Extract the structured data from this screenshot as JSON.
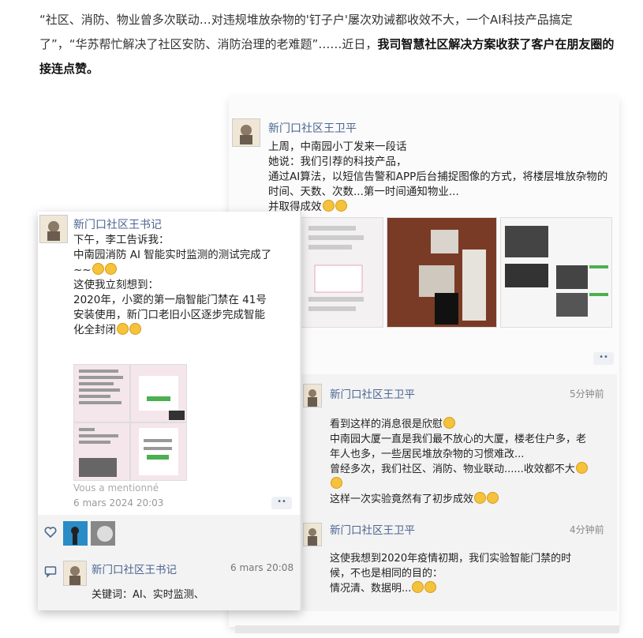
{
  "intro": {
    "part1": "“社区、消防、物业曾多次联动…对违规堆放杂物的'钉子户'屡次劝诫都收效不大，一个AI科技产品搞定了”，“华苏帮忙解决了社区安防、消防治理的老难题”……近日，",
    "bold": "我司智慧社区解决方案收获了客户在朋友圈的接连点赞。"
  },
  "back_post": {
    "author": "新门口社区王卫平",
    "lines": [
      "上周，中南园小丁发来一段话",
      "她说：我们引荐的科技产品，",
      "通过AI算法，以短信告警和APP后台捕捉图像的方式，将楼层堆放杂物的",
      "时间、天数、次数...第一时间通知物业...",
      "并取得成效"
    ],
    "comments": [
      {
        "author": "新门口社区王卫平",
        "time": "5分钟前",
        "lines": [
          "看到这样的消息很是欣慰",
          "中南园大厦一直是我们最不放心的大厦，楼老住户多，老",
          "年人也多，一些居民堆放杂物的习惯难改...",
          "曾经多次，我们社区、消防、物业联动......收效都不大",
          "",
          "这样一次实验竟然有了初步成效"
        ]
      },
      {
        "author": "新门口社区王卫平",
        "time": "4分钟前",
        "lines": [
          "这使我想到2020年疫情初期，我们实验智能门禁的时",
          "候，不也是相同的目的：",
          "情况清、数据明..."
        ]
      }
    ],
    "more": "••"
  },
  "front_post": {
    "author": "新门口社区王书记",
    "lines": [
      "下午，李工告诉我：",
      "中南园消防 AI 智能实时监测的测试完成了",
      "~~",
      "这使我立刻想到：",
      "2020年，小窦的第一扇智能门禁在 41号",
      "安装使用，新门口老旧小区逐步完成智能",
      "化全封闭"
    ],
    "mention": "Vous a mentionné",
    "date": "6 mars 2024 20:03",
    "more": "••",
    "comment": {
      "author": "新门口社区王书记",
      "time": "6 mars  20:08",
      "text": "关键词：AI、实时监测、"
    }
  },
  "colors": {
    "link": "#4a6592",
    "emoji": "#f5c33b",
    "heart": "#4a6592"
  },
  "icons": {
    "like": "heart-icon",
    "comment": "comment-icon"
  }
}
